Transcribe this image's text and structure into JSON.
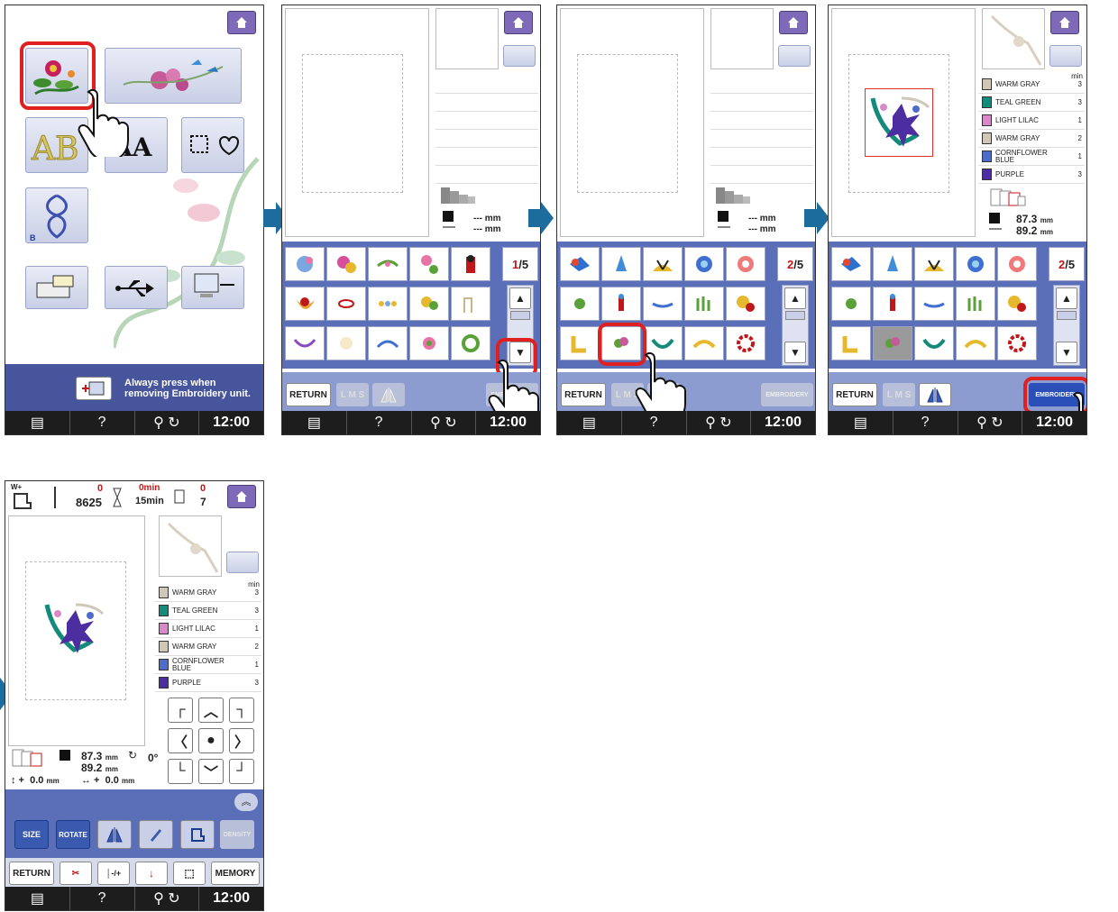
{
  "status_bar": {
    "clock": "12:00",
    "help": "?"
  },
  "panel1": {
    "notice": "Always press when removing Embroidery unit."
  },
  "pattern_grid": {
    "page1": {
      "current": "1",
      "total": "5"
    },
    "page2": {
      "current": "2",
      "total": "5"
    },
    "return_label": "RETURN",
    "lms_label": "L M S",
    "embroidery_label": "EMBROIDERY"
  },
  "dims_placeholder": {
    "w": "--- mm",
    "h": "--- mm"
  },
  "dims_selected": {
    "w": "87.3",
    "h": "89.2",
    "unit": "mm"
  },
  "thread_list": [
    {
      "name": "WARM GRAY",
      "min": "3",
      "color": "#cfc7b8"
    },
    {
      "name": "TEAL GREEN",
      "min": "3",
      "color": "#138a7a"
    },
    {
      "name": "LIGHT LILAC",
      "min": "1",
      "color": "#d989c8"
    },
    {
      "name": "WARM GRAY",
      "min": "2",
      "color": "#cfc7b8"
    },
    {
      "name": "CORNFLOWER BLUE",
      "min": "1",
      "color": "#4f6cc8"
    },
    {
      "name": "PURPLE",
      "min": "3",
      "color": "#4c2ea0"
    }
  ],
  "min_label": "min",
  "panel5": {
    "wplus": "W+",
    "stitch_done": "0",
    "stitch_total": "8625",
    "time_done": "0min",
    "time_total": "15min",
    "color_done": "0",
    "color_total": "7",
    "angle": "0°",
    "offset_v": "0.0",
    "offset_h": "0.0",
    "size_label": "SIZE",
    "rotate_label": "ROTATE",
    "density_label": "DENSITY",
    "return_label": "RETURN",
    "memory_label": "MEMORY"
  }
}
